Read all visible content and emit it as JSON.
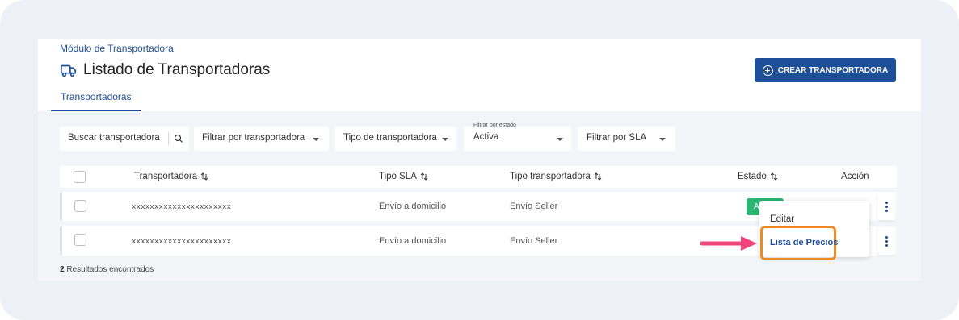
{
  "header": {
    "breadcrumb": "Módulo de Transportadora",
    "title": "Listado de Transportadoras",
    "create_button": "CREAR TRANSPORTADORA",
    "tab": "Transportadoras"
  },
  "filters": {
    "search_placeholder": "Buscar transportadora",
    "by_carrier": "Filtrar por transportadora",
    "carrier_type": "Tipo de transportadora",
    "status_label": "Filtrar por estado",
    "status_value": "Activa",
    "by_sla": "Filtrar por SLA"
  },
  "table": {
    "columns": [
      "Transportadora",
      "Tipo SLA",
      "Tipo transportadora",
      "Estado",
      "Acción"
    ],
    "rows": [
      {
        "name": "xxxxxxxxxxxxxxxxxxxxxx",
        "sla": "Envío a domicilio",
        "type": "Envío Seller",
        "status": "Activa"
      },
      {
        "name": "xxxxxxxxxxxxxxxxxxxxxx",
        "sla": "Envío a domicilio",
        "type": "Envío Seller",
        "status": ""
      }
    ],
    "status_badge_visible": "Ac"
  },
  "action_menu": {
    "items": [
      "Editar",
      "Lista de Precios"
    ]
  },
  "results": {
    "count": "2",
    "label": "Resultados encontrados"
  },
  "colors": {
    "primary": "#1d4f99",
    "active_badge": "#2bb673",
    "highlight": "#f0891f",
    "arrow": "#f0457a"
  }
}
